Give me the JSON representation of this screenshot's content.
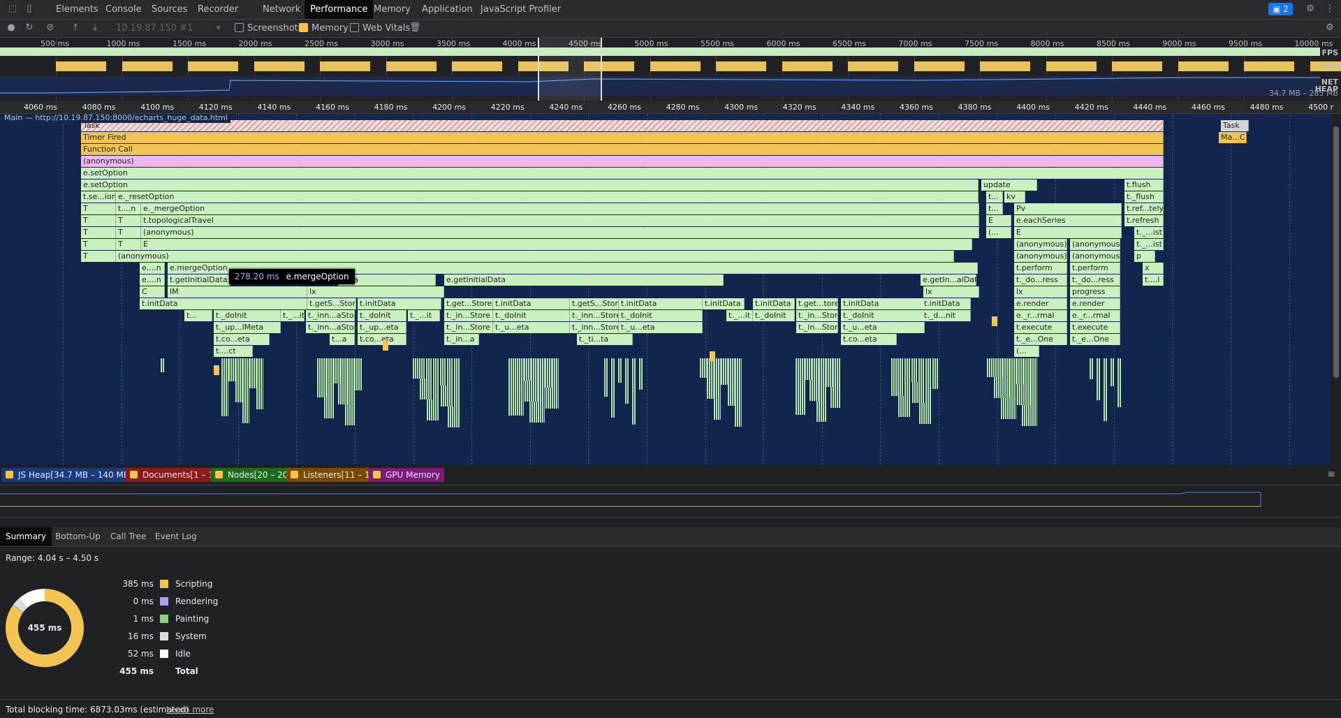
{
  "tabs": [
    {
      "label": "Elements",
      "active": false
    },
    {
      "label": "Console",
      "active": false
    },
    {
      "label": "Sources",
      "active": false
    },
    {
      "label": "Recorder",
      "active": false
    },
    {
      "label": "Network",
      "active": false
    },
    {
      "label": "Performance",
      "active": true
    },
    {
      "label": "Memory",
      "active": false
    },
    {
      "label": "Application",
      "active": false
    },
    {
      "label": "JavaScript Profiler",
      "active": false
    }
  ],
  "issues_badge": "2",
  "toolbar": {
    "profile_select": "10.19.87.150 #1",
    "screenshots_label": "Screenshots",
    "screenshots_checked": false,
    "memory_label": "Memory",
    "memory_checked": true,
    "webvitals_label": "Web Vitals",
    "webvitals_checked": false
  },
  "overview": {
    "ticks": [
      "500 ms",
      "1000 ms",
      "1500 ms",
      "2000 ms",
      "2500 ms",
      "3000 ms",
      "3500 ms",
      "4000 ms",
      "4500 ms",
      "5000 ms",
      "5500 ms",
      "6000 ms",
      "6500 ms",
      "7000 ms",
      "7500 ms",
      "8000 ms",
      "8500 ms",
      "9000 ms",
      "9500 ms",
      "10000 ms"
    ],
    "lanes": [
      "FPS",
      "CPU",
      "NET",
      "HEAP"
    ],
    "heap_range": "34.7 MB – 285 MB"
  },
  "ruler": {
    "ticks": [
      "4060 ms",
      "4080 ms",
      "4100 ms",
      "4120 ms",
      "4140 ms",
      "4160 ms",
      "4180 ms",
      "4200 ms",
      "4220 ms",
      "4240 ms",
      "4260 ms",
      "4280 ms",
      "4300 ms",
      "4320 ms",
      "4340 ms",
      "4360 ms",
      "4380 ms",
      "4400 ms",
      "4420 ms",
      "4440 ms",
      "4460 ms",
      "4480 ms",
      "4500 r"
    ]
  },
  "main_thread": "Main — http://10.19.87.150:8000/echarts_huge_data.html",
  "flame": {
    "rows": [
      [
        [
          "Task",
          "task"
        ],
        [
          "Task",
          "task-plain"
        ]
      ],
      [
        [
          "Timer Fired",
          "yellow"
        ],
        [
          "Ma...C",
          "yellow"
        ]
      ],
      [
        [
          "Function Call",
          "yellow"
        ]
      ],
      [
        [
          "(anonymous)",
          "pink"
        ]
      ],
      [
        [
          "e.setOption",
          "green"
        ]
      ],
      [
        [
          "e.setOption",
          "green"
        ],
        [
          "update",
          "green"
        ],
        [
          "t.flush",
          "green"
        ]
      ],
      [
        [
          "t.se...ion",
          "green"
        ],
        [
          "e._resetOption",
          "green"
        ],
        [
          "t...",
          "green"
        ],
        [
          "kv",
          "green"
        ],
        [
          "t._flush",
          "green"
        ]
      ],
      [
        [
          "T",
          "green"
        ],
        [
          "t....n",
          "green"
        ],
        [
          "e._mergeOption",
          "green"
        ],
        [
          "t...",
          "green"
        ],
        [
          "Pv",
          "green"
        ],
        [
          "t.ref...tely",
          "green"
        ]
      ],
      [
        [
          "T",
          "green"
        ],
        [
          "T",
          "green"
        ],
        [
          "t.topologicalTravel",
          "green"
        ],
        [
          "E",
          "green"
        ],
        [
          "e.eachSeries",
          "green"
        ],
        [
          "t.refresh",
          "green"
        ]
      ],
      [
        [
          "T",
          "green"
        ],
        [
          "T",
          "green"
        ],
        [
          "(anonymous)",
          "green"
        ],
        [
          "(...",
          "green"
        ],
        [
          "E",
          "green"
        ],
        [
          "t._...ist",
          "green"
        ]
      ],
      [
        [
          "T",
          "green"
        ],
        [
          "T",
          "green"
        ],
        [
          "E",
          "green"
        ],
        [
          "(anonymous)",
          "green"
        ],
        [
          "(anonymous)",
          "green"
        ],
        [
          "t._...ist",
          "green"
        ]
      ],
      [
        [
          "T",
          "green"
        ],
        [
          "(anonymous)",
          "green"
        ],
        [
          "(anonymous)",
          "green"
        ],
        [
          "(anonymous)",
          "green"
        ],
        [
          "p",
          "green"
        ]
      ],
      [
        [
          "e....n",
          "green"
        ],
        [
          "e.mergeOption",
          "green"
        ],
        [
          "t.perform",
          "green"
        ],
        [
          "t.perform",
          "green"
        ],
        [
          "x",
          "green"
        ]
      ],
      [
        [
          "e....n",
          "green"
        ],
        [
          "t.getInitialData",
          "green"
        ],
        [
          "Data",
          "green"
        ],
        [
          "e.getInitialData",
          "green"
        ],
        [
          "e.getIn...alData",
          "green"
        ],
        [
          "t._do...ress",
          "green"
        ],
        [
          "t._do...ress",
          "green"
        ],
        [
          "t....l",
          "green"
        ]
      ],
      [
        [
          "C",
          "green"
        ],
        [
          "IM",
          "green"
        ],
        [
          "lx",
          "green"
        ],
        [
          "lx",
          "green"
        ],
        [
          "lx",
          "green"
        ],
        [
          "progress",
          "green"
        ],
        [
          "progress",
          "green"
        ]
      ],
      [
        [
          "t.initData",
          "green"
        ],
        [
          "t.getS...Store",
          "green"
        ],
        [
          "t.initData",
          "green"
        ],
        [
          "t.get...Store",
          "green"
        ],
        [
          "t.initData",
          "green"
        ],
        [
          "t.getS...Store",
          "green"
        ],
        [
          "t.initData",
          "green"
        ],
        [
          "t.initData",
          "green"
        ],
        [
          "t.initData",
          "green"
        ],
        [
          "t.get...tore",
          "green"
        ],
        [
          "t.initData",
          "green"
        ],
        [
          "t.initData",
          "green"
        ],
        [
          "e.render",
          "green"
        ],
        [
          "e.render",
          "green"
        ]
      ],
      [
        [
          "t...",
          "green"
        ],
        [
          "t._doInit",
          "green"
        ],
        [
          "t._...it",
          "green"
        ],
        [
          "t._inn...aStore",
          "green"
        ],
        [
          "t._doInit",
          "green"
        ],
        [
          "t._...it",
          "green"
        ],
        [
          "t._in...Store",
          "green"
        ],
        [
          "t._doInit",
          "green"
        ],
        [
          "t._inn...Store",
          "green"
        ],
        [
          "t._doInit",
          "green"
        ],
        [
          "t._...it",
          "green"
        ],
        [
          "t._doInit",
          "green"
        ],
        [
          "t._in...Store",
          "green"
        ],
        [
          "t._doInit",
          "green"
        ],
        [
          "t._d...nit",
          "green"
        ],
        [
          "e._r...rmal",
          "green"
        ],
        [
          "e._r...rmal",
          "green"
        ]
      ],
      [
        [
          "t._up...lMeta",
          "green"
        ],
        [
          "t._inn...aStore",
          "green"
        ],
        [
          "t._up...eta",
          "green"
        ],
        [
          "t._in...Store",
          "green"
        ],
        [
          "t._u...eta",
          "green"
        ],
        [
          "t._inn...Store",
          "green"
        ],
        [
          "t._u...eta",
          "green"
        ],
        [
          "t._in...Store",
          "green"
        ],
        [
          "t._u...eta",
          "green"
        ],
        [
          "t.execute",
          "green"
        ],
        [
          "t.execute",
          "green"
        ]
      ],
      [
        [
          "t.co...eta",
          "green"
        ],
        [
          "t...a",
          "green"
        ],
        [
          "t.co...eta",
          "green"
        ],
        [
          "t._in...a",
          "green"
        ],
        [
          "t._ti...ta",
          "green"
        ],
        [
          "t.co...eta",
          "green"
        ],
        [
          "t._e...One",
          "green"
        ],
        [
          "t._e...One",
          "green"
        ]
      ],
      [
        [
          "t....ct",
          "green"
        ],
        [
          "(...",
          "green"
        ]
      ]
    ]
  },
  "tooltip": {
    "time": "278.20 ms",
    "name": "e.mergeOption"
  },
  "counters": [
    {
      "label": "JS Heap[34.7 MB – 140 MB]",
      "color": "#1a3a80"
    },
    {
      "label": "Documents[1 – 1]",
      "color": "#8b1a1a"
    },
    {
      "label": "Nodes[20 – 20]",
      "color": "#1e6b1e"
    },
    {
      "label": "Listeners[11 – 11]",
      "color": "#7a4a00"
    },
    {
      "label": "GPU Memory",
      "color": "#7a1a7a"
    }
  ],
  "detail_tabs": [
    {
      "label": "Summary",
      "active": true
    },
    {
      "label": "Bottom-Up",
      "active": false
    },
    {
      "label": "Call Tree",
      "active": false
    },
    {
      "label": "Event Log",
      "active": false
    }
  ],
  "summary": {
    "range": "Range: 4.04 s – 4.50 s",
    "donut_center": "455 ms",
    "rows": [
      {
        "value": "385 ms",
        "label": "Scripting",
        "color": "#f1c453",
        "ms": 385
      },
      {
        "value": "0 ms",
        "label": "Rendering",
        "color": "#af9cf6",
        "ms": 0
      },
      {
        "value": "1 ms",
        "label": "Painting",
        "color": "#8fd17f",
        "ms": 1
      },
      {
        "value": "16 ms",
        "label": "System",
        "color": "#dadce0",
        "ms": 16
      },
      {
        "value": "52 ms",
        "label": "Idle",
        "color": "#ffffff",
        "ms": 52
      }
    ],
    "total_value": "455 ms",
    "total_label": "Total"
  },
  "footer": {
    "blocking": "Total blocking time: 6873.03ms (estimated)",
    "learn_more": "Learn more"
  }
}
